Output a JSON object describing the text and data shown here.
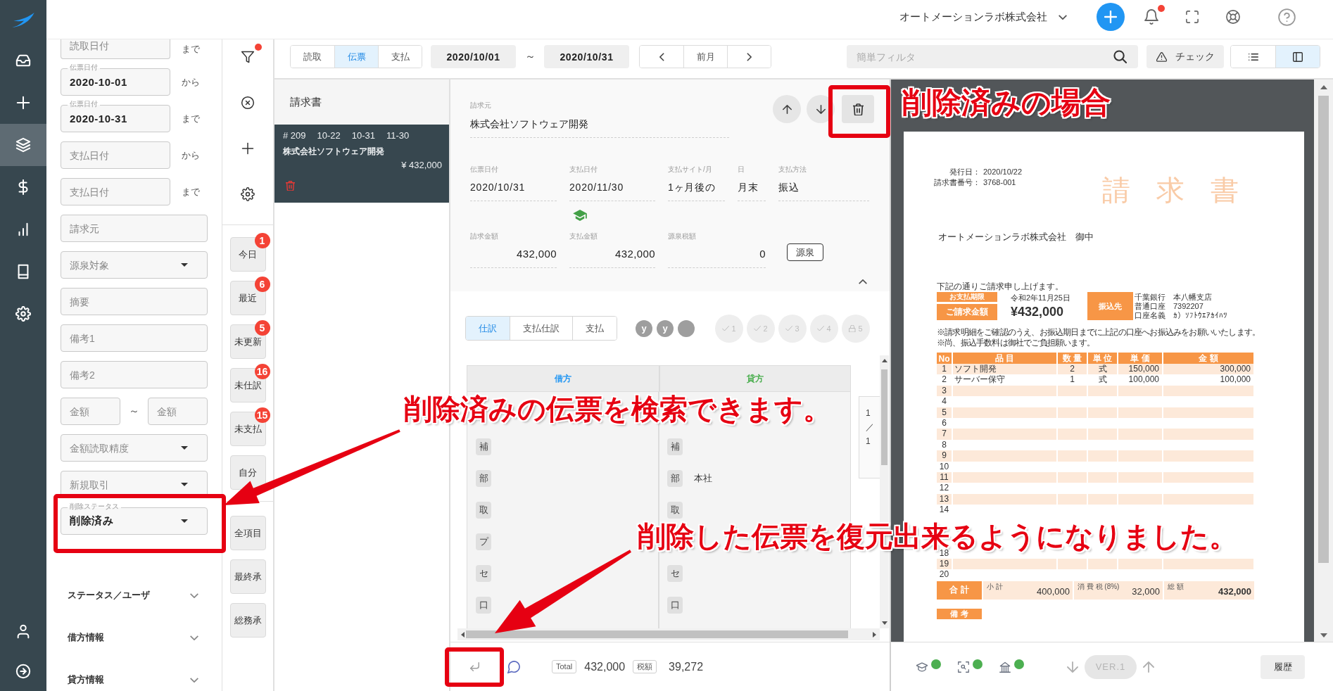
{
  "nav": {
    "items": [
      {
        "kind": "inbox",
        "selected": false
      },
      {
        "kind": "add",
        "selected": false
      },
      {
        "kind": "layers",
        "selected": true
      },
      {
        "kind": "money",
        "selected": false
      },
      {
        "kind": "chart",
        "selected": false
      },
      {
        "kind": "book",
        "selected": false
      },
      {
        "kind": "settings",
        "selected": false
      }
    ],
    "bottom_items": [
      {
        "kind": "user",
        "selected": false
      },
      {
        "kind": "logout",
        "selected": false
      }
    ]
  },
  "header": {
    "company": "オートメーションラボ株式会社",
    "notifications_unread": true
  },
  "filter_panel": {
    "fields": [
      {
        "kind": "text",
        "placeholder": "読取日付",
        "suffix": "まで",
        "highlighted": false
      },
      {
        "kind": "text",
        "label": "伝票日付",
        "value": "2020-10-01",
        "suffix": "から",
        "highlighted": false
      },
      {
        "kind": "text",
        "label": "伝票日付",
        "value": "2020-10-31",
        "suffix": "まで",
        "highlighted": false
      },
      {
        "kind": "text",
        "placeholder": "支払日付",
        "suffix": "から",
        "highlighted": false
      },
      {
        "kind": "text",
        "placeholder": "支払日付",
        "suffix": "まで",
        "highlighted": false
      },
      {
        "kind": "text",
        "placeholder": "請求元",
        "highlighted": false
      },
      {
        "kind": "select",
        "placeholder": "源泉対象",
        "highlighted": false
      },
      {
        "kind": "text",
        "placeholder": "摘要",
        "highlighted": false
      },
      {
        "kind": "text",
        "placeholder": "備考1",
        "highlighted": false
      },
      {
        "kind": "text",
        "placeholder": "備考2",
        "highlighted": false
      },
      {
        "kind": "range",
        "from_placeholder": "金額",
        "separator": "～",
        "to_placeholder": "金額",
        "highlighted": false
      },
      {
        "kind": "select",
        "placeholder": "金額読取精度",
        "highlighted": false
      },
      {
        "kind": "select",
        "placeholder": "新規取引",
        "highlighted": false
      },
      {
        "kind": "select",
        "label": "削除ステータス",
        "value": "削除済み",
        "highlighted": true
      }
    ],
    "sections": [
      {
        "label": "ステータス／ユーザ",
        "expanded": false
      },
      {
        "label": "借方情報",
        "expanded": false
      },
      {
        "label": "貸方情報",
        "expanded": false
      }
    ]
  },
  "filter_tools": {
    "tools": [
      {
        "kind": "filter",
        "dot": true
      },
      {
        "kind": "clear",
        "dot": false
      },
      {
        "kind": "add",
        "dot": false
      },
      {
        "kind": "settings",
        "dot": false
      }
    ],
    "quick_filters": [
      {
        "label": "今日",
        "count": "1"
      },
      {
        "label": "最近",
        "count": "6"
      },
      {
        "label": "未更新",
        "count": "5"
      },
      {
        "label": "未仕訳",
        "count": "16"
      },
      {
        "label": "未支払",
        "count": "15"
      },
      {
        "label": "自分"
      }
    ],
    "views": [
      "全項目",
      "最終承",
      "総務承"
    ]
  },
  "toolbar": {
    "source_tabs": [
      {
        "label": "読取",
        "selected": false
      },
      {
        "label": "伝票",
        "selected": true
      },
      {
        "label": "支払",
        "selected": false
      }
    ],
    "date_from": "2020/10/01",
    "range_separator": "～",
    "date_to": "2020/10/31",
    "period_label": "前月",
    "filter_placeholder": "簡単フィルタ",
    "check_label": "チェック",
    "view_modes": [
      {
        "kind": "list",
        "selected": false
      },
      {
        "kind": "split",
        "selected": true
      }
    ]
  },
  "invoice_list": {
    "title": "請求書",
    "items": [
      {
        "number": "# 209",
        "dates": [
          "10-22",
          "10-31",
          "11-30"
        ],
        "vendor": "株式会社ソフトウェア開発",
        "amount": "¥ 432,000",
        "selected": true,
        "deleted": true
      }
    ]
  },
  "detail": {
    "vendor_label": "請求元",
    "vendor": "株式会社ソフトウェア開発",
    "delete_highlighted": true,
    "fields": [
      {
        "label": "伝票日付",
        "value": "2020/10/31",
        "learned": false
      },
      {
        "label": "支払日付",
        "value": "2020/11/30",
        "learned": true
      },
      {
        "label": "支払サイト/月",
        "value": "1ヶ月後の",
        "learned": false
      },
      {
        "label": "日",
        "value": "月末",
        "learned": false
      },
      {
        "label": "支払方法",
        "value": "振込",
        "learned": false
      }
    ],
    "amounts": [
      {
        "label": "請求金額",
        "value": "432,000"
      },
      {
        "label": "支払金額",
        "value": "432,000"
      },
      {
        "label": "源泉税額",
        "value": "0"
      }
    ],
    "withholding_button": "源泉",
    "expanded": true
  },
  "journal": {
    "tabs": [
      {
        "label": "仕訳",
        "selected": true
      },
      {
        "label": "支払仕訳",
        "selected": false
      },
      {
        "label": "支払",
        "selected": false
      }
    ],
    "approvers": [
      {
        "kind": "user",
        "initial": "y"
      },
      {
        "kind": "user",
        "initial": "y"
      },
      {
        "kind": "empty"
      }
    ],
    "steps": [
      {
        "kind": "check",
        "label": "1",
        "approved": false
      },
      {
        "kind": "check",
        "label": "2",
        "approved": false
      },
      {
        "kind": "check",
        "label": "3",
        "approved": false
      },
      {
        "kind": "check",
        "label": "4",
        "approved": false
      },
      {
        "kind": "lock",
        "label": "5",
        "approved": false
      }
    ],
    "columns": [
      {
        "label": "借方",
        "color": "#2196f3"
      },
      {
        "label": "貸方",
        "color": "#4caf50"
      }
    ],
    "rows": [
      {
        "debit_tag": "補",
        "credit_tag": "補"
      },
      {
        "debit_tag": "部",
        "credit_tag": "部",
        "credit_value": "本社"
      },
      {
        "debit_tag": "取",
        "credit_tag": "取"
      },
      {
        "debit_tag": "プ"
      },
      {
        "debit_tag": "セ",
        "credit_tag": "セ"
      },
      {
        "debit_tag": "口",
        "credit_tag": "口"
      }
    ],
    "pager": [
      "1",
      "／",
      "1"
    ]
  },
  "summary": {
    "restore_highlighted": true,
    "total_label": "Total",
    "total": "432,000",
    "tax_label": "税額",
    "tax": "39,272"
  },
  "preview": {
    "document": {
      "title": "請 求 書",
      "meta": [
        {
          "label": "発行日：",
          "value": "2020/10/22"
        },
        {
          "label": "請求書番号：",
          "value": "3768-001"
        }
      ],
      "addressee": "オートメーションラボ株式会社　御中",
      "intro": "下記の通りご請求申し上げます。",
      "due_label": "お支払期限",
      "due_date": "令和2年11月25日",
      "amount_label": "ご請求金額",
      "amount": "¥432,000",
      "bank_label": "振込先",
      "bank_lines": [
        "千葉銀行　本八幡支店",
        "普通口座　7392207",
        "口座名義　ｶ）ｿﾌﾄｳｴｱｶｲﾊﾂ"
      ],
      "notes": [
        "※請求明細をご確認のうえ、お振込期日までに上記の口座へお振込みをお願いいたします。",
        "※尚、振込手数料は御社でご負担願います。"
      ],
      "columns": [
        "No",
        "品 目",
        "数 量",
        "単 位",
        "単 価",
        "金 額"
      ],
      "rows": [
        {
          "no": "1",
          "item": "ソフト開発",
          "qty": "2",
          "unit": "式",
          "price": "150,000",
          "amount": "300,000"
        },
        {
          "no": "2",
          "item": "サーバー保守",
          "qty": "1",
          "unit": "式",
          "price": "100,000",
          "amount": "100,000"
        },
        {
          "no": "3"
        },
        {
          "no": "4"
        },
        {
          "no": "5"
        },
        {
          "no": "6"
        },
        {
          "no": "7"
        },
        {
          "no": "8"
        },
        {
          "no": "9"
        },
        {
          "no": "10"
        },
        {
          "no": "11"
        },
        {
          "no": "12"
        },
        {
          "no": "13"
        },
        {
          "no": "14"
        },
        {},
        {},
        {},
        {
          "no": "18"
        },
        {
          "no": "19"
        },
        {
          "no": "20"
        }
      ],
      "total_label": "合 計",
      "totals": [
        {
          "label": "小 計",
          "value": "400,000"
        },
        {
          "label": "消 費 税 (8%)",
          "value": "32,000"
        },
        {
          "label": "総 額",
          "value": "432,000"
        }
      ],
      "remarks_label": "備 考"
    },
    "status": [
      {
        "kind": "learned",
        "ok": true
      },
      {
        "kind": "scan",
        "ok": true
      },
      {
        "kind": "bank",
        "ok": true
      }
    ],
    "version": "VER.1",
    "history_button": "履歴"
  },
  "annotations": [
    {
      "text": "削除済みの場合"
    },
    {
      "text": "削除済みの伝票を検索できます。"
    },
    {
      "text": "削除した伝票を復元出来るようになりました。"
    }
  ]
}
